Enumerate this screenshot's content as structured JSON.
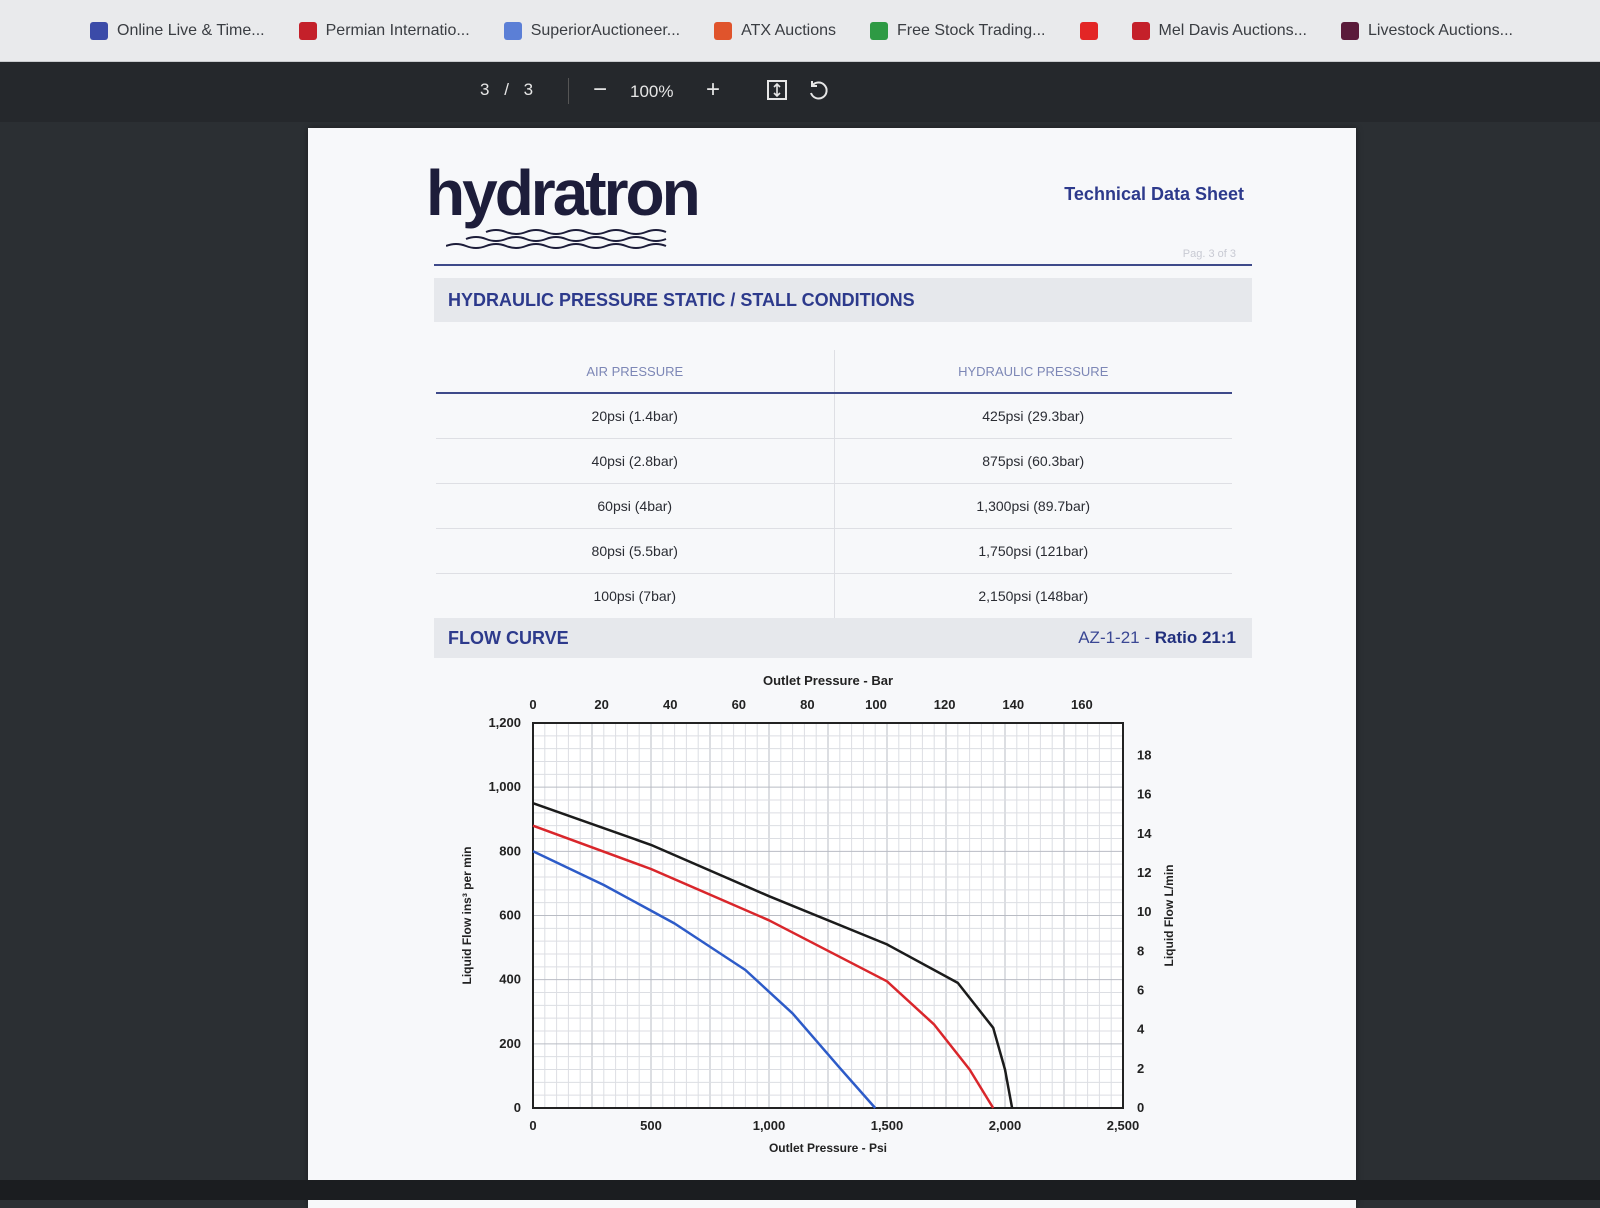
{
  "bookmarks": [
    {
      "label": "Online Live & Time...",
      "color": "#3b4ba8"
    },
    {
      "label": "Permian Internatio...",
      "color": "#c4202a"
    },
    {
      "label": "SuperiorAuctioneer...",
      "color": "#5b7fd6"
    },
    {
      "label": "ATX Auctions",
      "color": "#e0542c"
    },
    {
      "label": "Free Stock Trading...",
      "color": "#2e9a44"
    },
    {
      "label": "",
      "color": "#e32626"
    },
    {
      "label": "Mel Davis Auctions...",
      "color": "#c4202a"
    },
    {
      "label": "Livestock Auctions...",
      "color": "#5a1a3a"
    }
  ],
  "toolbar": {
    "current_page": "3",
    "page_separator": "/",
    "total_pages": "3",
    "zoom": "100%",
    "zoom_out": "−",
    "zoom_in": "+"
  },
  "document": {
    "logo": "hydratron",
    "doc_type": "Technical Data Sheet",
    "page_label": "Pag. 3 of 3",
    "section1_title": "HYDRAULIC PRESSURE STATIC / STALL CONDITIONS",
    "table": {
      "headers": [
        "AIR PRESSURE",
        "HYDRAULIC PRESSURE"
      ],
      "rows": [
        [
          "20psi (1.4bar)",
          "425psi (29.3bar)"
        ],
        [
          "40psi (2.8bar)",
          "875psi (60.3bar)"
        ],
        [
          "60psi (4bar)",
          "1,300psi (89.7bar)"
        ],
        [
          "80psi (5.5bar)",
          "1,750psi (121bar)"
        ],
        [
          "100psi (7bar)",
          "2,150psi (148bar)"
        ]
      ]
    },
    "section2_title": "FLOW CURVE",
    "model": "AZ-1-21",
    "model_sep": " - ",
    "ratio": "Ratio 21:1"
  },
  "chart_data": {
    "type": "line",
    "title": "",
    "xlabel": "Outlet Pressure - Psi",
    "x2label": "Outlet Pressure - Bar",
    "ylabel": "Liquid Flow ins³ per min",
    "y2label": "Liquid Flow L/min",
    "xlim": [
      0,
      2500
    ],
    "ylim": [
      0,
      1200
    ],
    "x_ticks": [
      "0",
      "500",
      "1,000",
      "1,500",
      "2,000",
      "2,500"
    ],
    "x_tick_values": [
      0,
      500,
      1000,
      1500,
      2000,
      2500
    ],
    "y_ticks": [
      "0",
      "200",
      "400",
      "600",
      "800",
      "1,000",
      "1,200"
    ],
    "y_tick_values": [
      0,
      200,
      400,
      600,
      800,
      1000,
      1200
    ],
    "x2_ticks": [
      "0",
      "20",
      "40",
      "60",
      "80",
      "100",
      "120",
      "140",
      "160"
    ],
    "x2_tick_values": [
      0,
      20,
      40,
      60,
      80,
      100,
      120,
      140,
      160
    ],
    "x2_lim": [
      0,
      172
    ],
    "y2_ticks": [
      "0",
      "2",
      "4",
      "6",
      "8",
      "10",
      "12",
      "14",
      "16",
      "18"
    ],
    "y2_tick_values": [
      0,
      2,
      4,
      6,
      8,
      10,
      12,
      14,
      16,
      18
    ],
    "y2_lim": [
      0,
      19.66
    ],
    "grid": true,
    "series": [
      {
        "color": "#1b1b1b",
        "x": [
          0,
          500,
          1000,
          1500,
          1800,
          1950,
          2000,
          2030
        ],
        "y": [
          950,
          820,
          660,
          510,
          390,
          250,
          120,
          0
        ]
      },
      {
        "color": "#d9262b",
        "x": [
          0,
          500,
          1000,
          1500,
          1700,
          1850,
          1950
        ],
        "y": [
          880,
          745,
          585,
          395,
          260,
          120,
          0
        ]
      },
      {
        "color": "#2d5bc8",
        "x": [
          0,
          300,
          600,
          900,
          1100,
          1300,
          1450
        ],
        "y": [
          800,
          695,
          575,
          430,
          295,
          125,
          0
        ]
      }
    ]
  }
}
